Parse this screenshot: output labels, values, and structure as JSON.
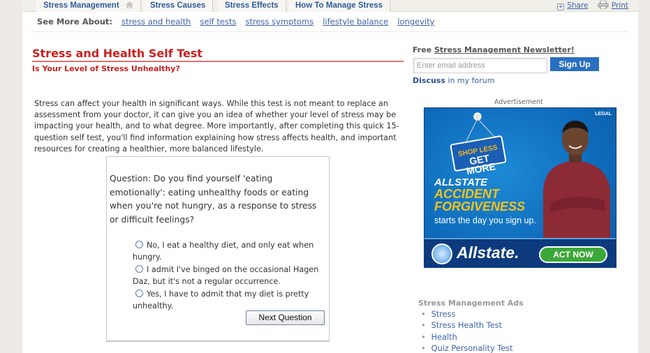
{
  "nav": {
    "tabs": [
      {
        "label": "Stress Management",
        "icon": "home-icon"
      },
      {
        "label": "Stress Causes"
      },
      {
        "label": "Stress Effects"
      },
      {
        "label": "How To Manage Stress"
      }
    ],
    "share_label": "Share",
    "print_label": "Print"
  },
  "see_more": {
    "label": "See More About:",
    "links": [
      "stress and health",
      "self tests",
      "stress symptoms",
      "lifestyle balance",
      "longevity"
    ]
  },
  "article": {
    "title": "Stress and Health Self Test",
    "subtitle": "Is Your Level of Stress Unhealthy?",
    "intro": "Stress can affect your health in significant ways. While this test is not meant to replace an assessment from your doctor, it can give you an idea of whether your level of stress may be impacting your health, and to what degree. More importantly, after completing this quick 15-question self test, you'll find information explaining how stress affects health, and important resources for creating a healthier, more balanced lifestyle."
  },
  "quiz": {
    "question": "Question: Do you find yourself 'eating emotionally': eating unhealthy foods or eating when you're not hungry, as a response to stress or difficult feelings?",
    "options": [
      "No, I eat a healthy diet, and only eat when hungry.",
      "I admit I've binged on the occasional Hagen Daz, but it's not a regular occurrence.",
      "Yes, I have to admit that my diet is pretty unhealthy."
    ],
    "next_label": "Next Question"
  },
  "sidebar": {
    "newsletter_prefix": "Free",
    "newsletter_link": "Stress Management Newsletter!",
    "email_placeholder": "Enter email address",
    "signup_label": "Sign Up",
    "discuss_bold": "Discuss",
    "discuss_rest": " in my forum",
    "ad_label": "Advertisement",
    "ad": {
      "legal": "LEGAL",
      "sign_line1": "SHOP LESS",
      "sign_line2": "GET MORE",
      "headline1": "ALLSTATE",
      "headline2": "ACCIDENT",
      "headline3": "FORGIVENESS",
      "subtext": "starts the day you sign up.",
      "brand": "Allstate.",
      "cta": "ACT NOW",
      "colors": {
        "background": "#0f6dbd",
        "accent": "#f5c21a",
        "cta": "#3da83a",
        "shirt": "#8c2a35"
      }
    },
    "ads_title": "Stress Management Ads",
    "ads_links": [
      "Stress",
      "Stress Health Test",
      "Health",
      "Quiz Personality Test"
    ]
  },
  "colors": {
    "title_red": "#cc1f1f",
    "link_blue": "#3c63a8",
    "signup_blue": "#2a6fc0"
  }
}
